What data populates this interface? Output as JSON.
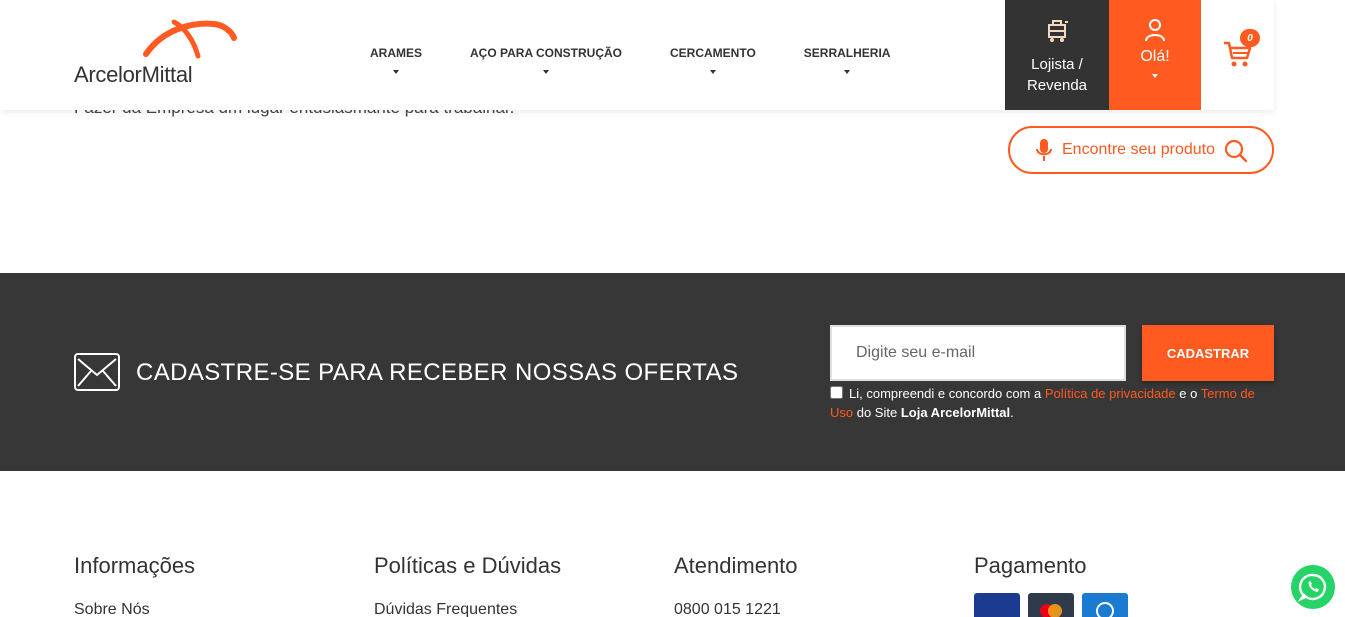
{
  "background_text": "Fazer da Empresa um lugar entusiasmante para trabalhar.",
  "header": {
    "logo_text": "ArcelorMittal",
    "nav": [
      {
        "label": "ARAMES"
      },
      {
        "label": "AÇO PARA CONSTRUÇÃO"
      },
      {
        "label": "CERCAMENTO"
      },
      {
        "label": "SERRALHERIA"
      }
    ],
    "lojista_line1": "Lojista /",
    "lojista_line2": "Revenda",
    "ola_label": "Olá!",
    "cart_count": "0"
  },
  "search": {
    "label": "Encontre seu produto"
  },
  "newsletter": {
    "title": "CADASTRE-SE PARA RECEBER NOSSAS OFERTAS",
    "email_placeholder": "Digite seu e-mail",
    "submit_label": "CADASTRAR",
    "consent_prefix": "Li, compreendi e concordo com a ",
    "privacy_link": "Política de privacidade",
    "consent_mid": " e o ",
    "terms_link": "Termo de Uso",
    "consent_suffix": " do Site ",
    "site_name": "Loja ArcelorMittal",
    "consent_end": "."
  },
  "footer": {
    "col1_title": "Informações",
    "col1_item": "Sobre Nós",
    "col2_title": "Políticas e Dúvidas",
    "col2_item": "Dúvidas Frequentes",
    "col3_title": "Atendimento",
    "col3_item": "0800 015 1221",
    "col4_title": "Pagamento"
  },
  "colors": {
    "accent": "#ff5a1f",
    "dark": "#333333",
    "band": "#373737",
    "whatsapp": "#25d366"
  }
}
